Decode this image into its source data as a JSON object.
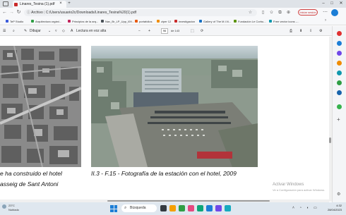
{
  "browser": {
    "tab_title": "Linares_Tesina (1).pdf",
    "url": "C:/Users/usuario2c/Downloads/Linares_Tesina%20(1).pdf",
    "url_prefix": "Archivo",
    "signin_label": "Iniciar sesión",
    "new_tab": "+",
    "close_tab": "×"
  },
  "bookmarks": [
    {
      "label": "TeP Studio",
      "color": "#3b5bdb"
    },
    {
      "label": "Arquitectura orgáni...",
      "color": "#2f9e44"
    },
    {
      "label": "Principios de la arq...",
      "color": "#c2255c"
    },
    {
      "label": "Nav_Br_LP_Upp_l09...",
      "color": "#495057"
    },
    {
      "label": "portafolios",
      "color": "#e8590c"
    },
    {
      "label": "ziper 12",
      "color": "#f08c00"
    },
    {
      "label": "investigacion",
      "color": "#c92a2a"
    },
    {
      "label": "Gallery of The M.I.N...",
      "color": "#1971c2"
    },
    {
      "label": "Fundación Le Corbu...",
      "color": "#5c940d"
    },
    {
      "label": "Free vector icons -...",
      "color": "#1098ad"
    }
  ],
  "pdf_toolbar": {
    "draw_label": "Dibujar",
    "read_aloud_label": "Lectura en voz alta",
    "page_current": "96",
    "page_total": "de 143",
    "zoom_minus": "−",
    "zoom_plus": "+"
  },
  "document": {
    "caption_left_line1": "e ha construido el hotel",
    "caption_left_line2": "asseig de Sant Antoni",
    "caption_right": "II.3 - F.15 - Fotografía de la estación con el hotel, 2009"
  },
  "watermark": {
    "title": "Activar Windows",
    "subtitle": "Ve a Configuración para activar Windows."
  },
  "taskbar": {
    "weather_temp": "23°C",
    "weather_desc": "Nublado",
    "search_label": "Búsqueda",
    "time": "4:32",
    "date": "28/04/2023"
  }
}
